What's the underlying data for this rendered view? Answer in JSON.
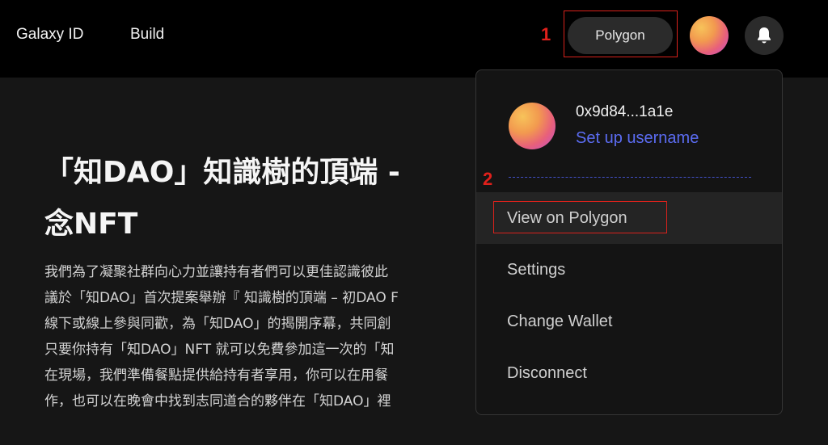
{
  "nav": {
    "galaxy_id": "Galaxy ID",
    "build": "Build"
  },
  "header": {
    "network_label": "Polygon",
    "avatar_icon": "user-avatar",
    "bell_icon": "bell-icon"
  },
  "annotations": {
    "step1": "1",
    "step2": "2",
    "color": "#d9221c"
  },
  "article": {
    "title_line1": "「知DAO」知識樹的頂端 - ",
    "title_line2": "念NFT",
    "body_lines": [
      "我們為了凝聚社群向心力並讓持有者們可以更佳認識彼此",
      "議於「知DAO」首次提案舉辦『 知識樹的頂端 – 初DAO F",
      "線下或線上參與同歡，為「知DAO」的揭開序幕，共同創",
      "只要你持有「知DAO」NFT 就可以免費參加這一次的「知",
      "在現場，我們準備餐點提供給持有者享用，你可以在用餐",
      "作，也可以在晚會中找到志同道合的夥伴在「知DAO」裡"
    ]
  },
  "dropdown": {
    "address": "0x9d84...1a1e",
    "setup_username": "Set up username",
    "items": [
      {
        "label": "View on Polygon"
      },
      {
        "label": "Settings"
      },
      {
        "label": "Change Wallet"
      },
      {
        "label": "Disconnect"
      }
    ]
  },
  "colors": {
    "accent_link": "#5b6cf2",
    "background": "#161616",
    "topbar": "#000000"
  }
}
